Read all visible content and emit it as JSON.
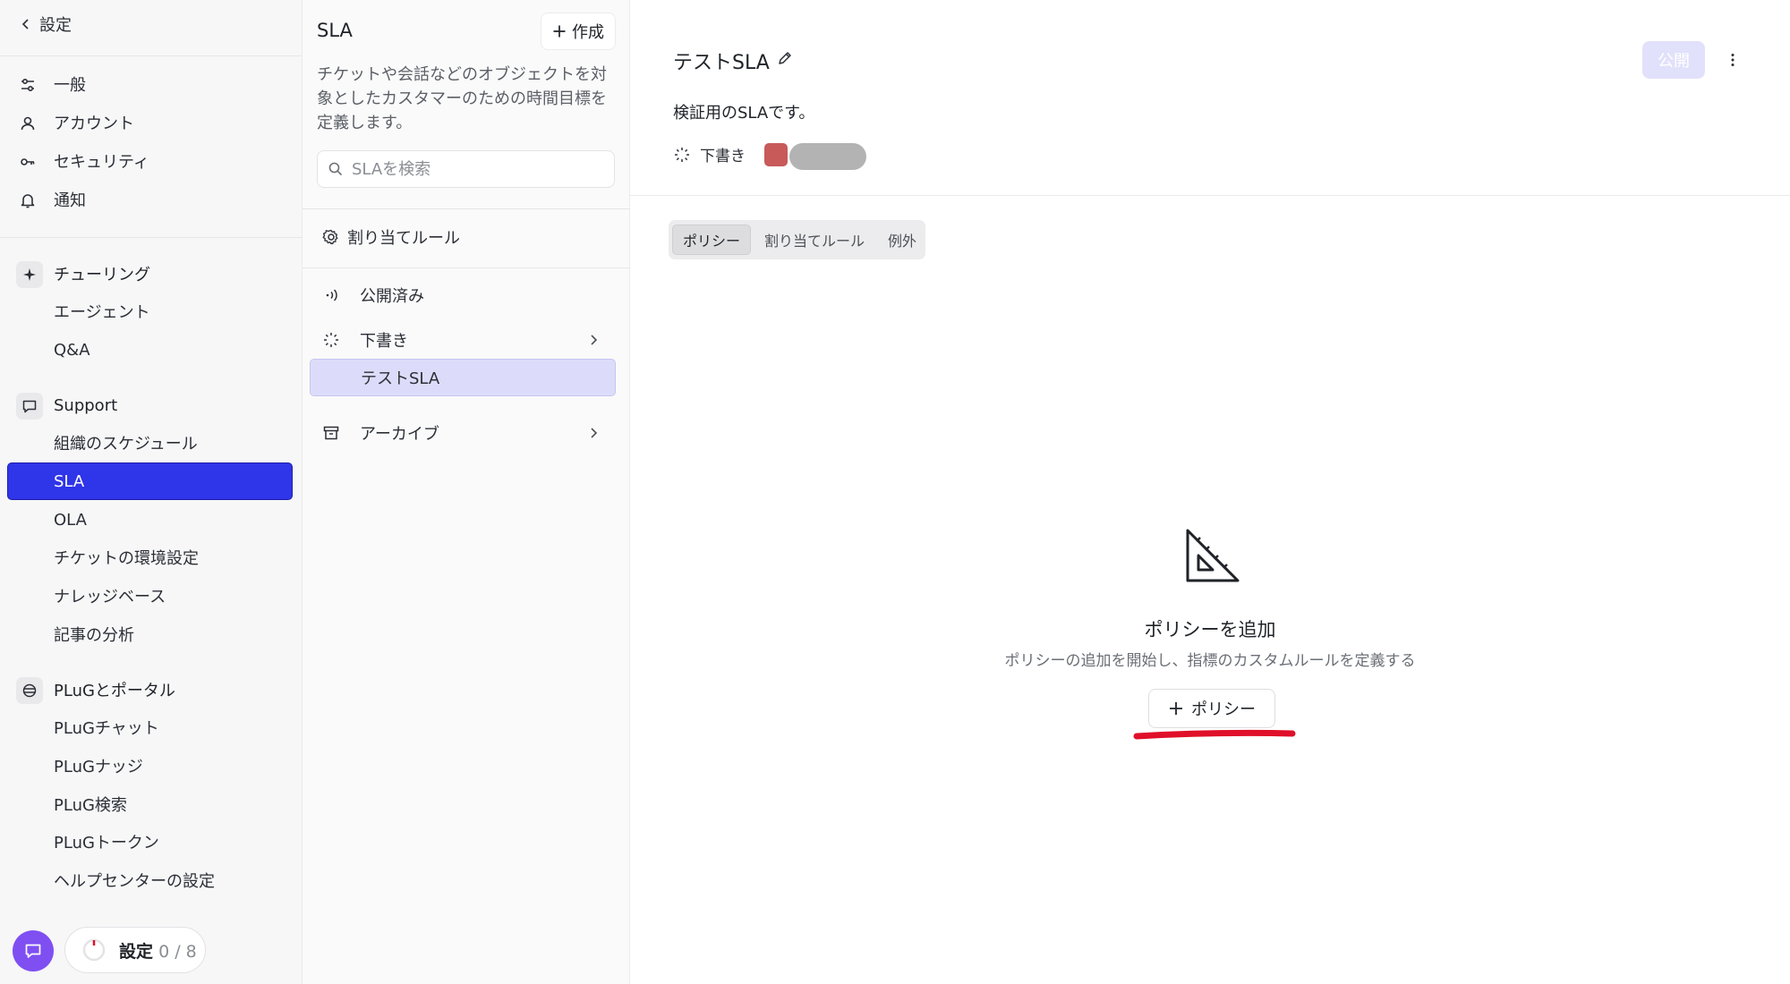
{
  "sidebar": {
    "back_label": "設定",
    "items": [
      {
        "label": "一般",
        "icon": "sliders-icon"
      },
      {
        "label": "アカウント",
        "icon": "user-icon"
      },
      {
        "label": "セキュリティ",
        "icon": "key-icon"
      },
      {
        "label": "通知",
        "icon": "bell-icon"
      }
    ],
    "sections": [
      {
        "label": "チューリング",
        "icon": "sparkle-icon",
        "items": [
          "エージェント",
          "Q&A"
        ]
      },
      {
        "label": "Support",
        "icon": "chat-bubble-icon",
        "items": [
          "組織のスケジュール",
          "SLA",
          "OLA",
          "チケットの環境設定",
          "ナレッジベース",
          "記事の分析"
        ]
      },
      {
        "label": "PLuGとポータル",
        "icon": "globe-icon",
        "items": [
          "PLuGチャット",
          "PLuGナッジ",
          "PLuG検索",
          "PLuGトークン",
          "ヘルプセンターの設定"
        ]
      }
    ],
    "active_item": "SLA",
    "progress": {
      "label": "設定",
      "count": "0 / 8"
    }
  },
  "list_panel": {
    "title": "SLA",
    "create_label": "作成",
    "description": "チケットや会話などのオブジェクトを対象としたカスタマーのための時間目標を定義します。",
    "search_placeholder": "SLAを検索",
    "assignment_rules_label": "割り当てルール",
    "published_label": "公開済み",
    "draft_label": "下書き",
    "draft_items": [
      "テストSLA"
    ],
    "archive_label": "アーカイブ"
  },
  "detail": {
    "title": "テストSLA",
    "publish_label": "公開",
    "description": "検証用のSLAです。",
    "status_label": "下書き",
    "tabs": [
      "ポリシー",
      "割り当てルール",
      "例外"
    ],
    "active_tab": "ポリシー",
    "empty_state": {
      "title": "ポリシーを追加",
      "subtitle": "ポリシーの追加を開始し、指標のカスタムルールを定義する",
      "button_label": "ポリシー",
      "icon": "set-square-icon"
    }
  },
  "colors": {
    "accent": "#2f35e8",
    "publish_disabled": "#e1e1fb",
    "chat_fab": "#7f4ff2",
    "annotation_red": "#e0102a"
  }
}
